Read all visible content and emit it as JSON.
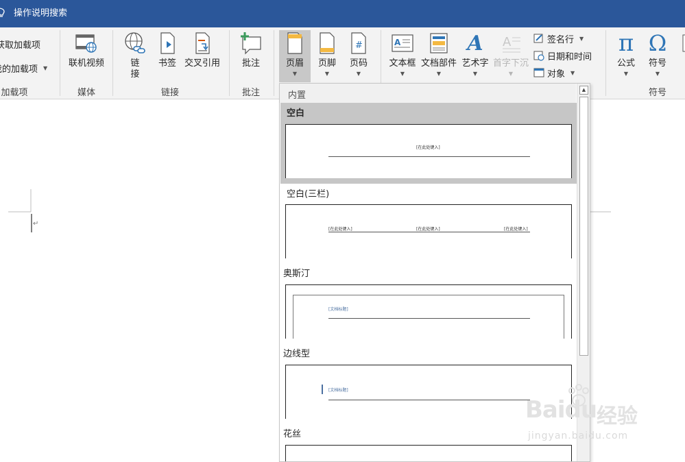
{
  "titlebar": {
    "tell_me": "操作说明搜索"
  },
  "ribbon": {
    "addins": {
      "get_addins": "获取加载项",
      "my_addins": "我的加载项",
      "group": "加载项"
    },
    "media": {
      "online_video": "联机视频",
      "group": "媒体"
    },
    "links": {
      "link_1": "链",
      "link_2": "接",
      "bookmark": "书签",
      "cross_ref": "交叉引用",
      "group": "链接"
    },
    "comments": {
      "comment": "批注",
      "group": "批注"
    },
    "header_footer": {
      "header": "页眉",
      "footer": "页脚",
      "page_number": "页码"
    },
    "text": {
      "text_box": "文本框",
      "quick_parts": "文档部件",
      "word_art": "艺术字",
      "drop_cap": "首字下沉",
      "signature_line": "签名行",
      "date_time": "日期和时间",
      "object": "对象"
    },
    "symbols": {
      "equation": "公式",
      "symbol": "符号",
      "group": "符号"
    },
    "icons": {
      "equation_glyph": "π",
      "symbol_glyph": "Ω",
      "word_art_glyph": "A",
      "number_glyph": "#"
    }
  },
  "document": {
    "paragraph_mark": "↵"
  },
  "gallery": {
    "section": "内置",
    "items": [
      {
        "title": "空白",
        "placeholders": [
          "[在此处键入]"
        ]
      },
      {
        "title": "空白(三栏)",
        "placeholders": [
          "[在此处键入]",
          "[在此处键入]",
          "[在此处键入]"
        ]
      },
      {
        "title": "奥斯汀",
        "placeholders": [
          "[文档标题]"
        ]
      },
      {
        "title": "边线型",
        "placeholders": [
          "[文档标题]"
        ]
      },
      {
        "title": "花丝",
        "placeholders": []
      }
    ]
  },
  "watermark": {
    "brand": "Baidu",
    "brand_cn": "经验",
    "url": "jingyan.baidu.com"
  },
  "colors": {
    "titlebar": "#2b579a",
    "ribbon": "#f3f3f3",
    "selected": "#c6c6c6"
  }
}
